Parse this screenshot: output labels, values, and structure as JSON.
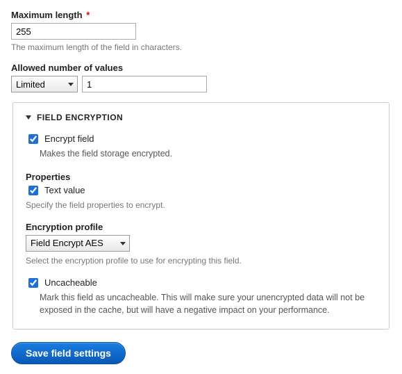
{
  "maxlen": {
    "label": "Maximum length",
    "required_marker": "*",
    "value": "255",
    "description": "The maximum length of the field in characters."
  },
  "cardinality": {
    "label": "Allowed number of values",
    "mode": "Limited",
    "number": "1"
  },
  "encryption": {
    "legend": "Field Encryption",
    "encrypt": {
      "label": "Encrypt field",
      "checked": true,
      "desc": "Makes the field storage encrypted."
    },
    "properties": {
      "heading": "Properties",
      "text_value_label": "Text value",
      "text_value_checked": true,
      "desc": "Specify the field properties to encrypt."
    },
    "profile": {
      "label": "Encryption profile",
      "selected": "Field Encrypt AES",
      "desc": "Select the encryption profile to use for encrypting this field."
    },
    "uncacheable": {
      "label": "Uncacheable",
      "checked": true,
      "desc": "Mark this field as uncacheable. This will make sure your unencrypted data will not be exposed in the cache, but will have a negative impact on your performance."
    }
  },
  "actions": {
    "save": "Save field settings"
  }
}
